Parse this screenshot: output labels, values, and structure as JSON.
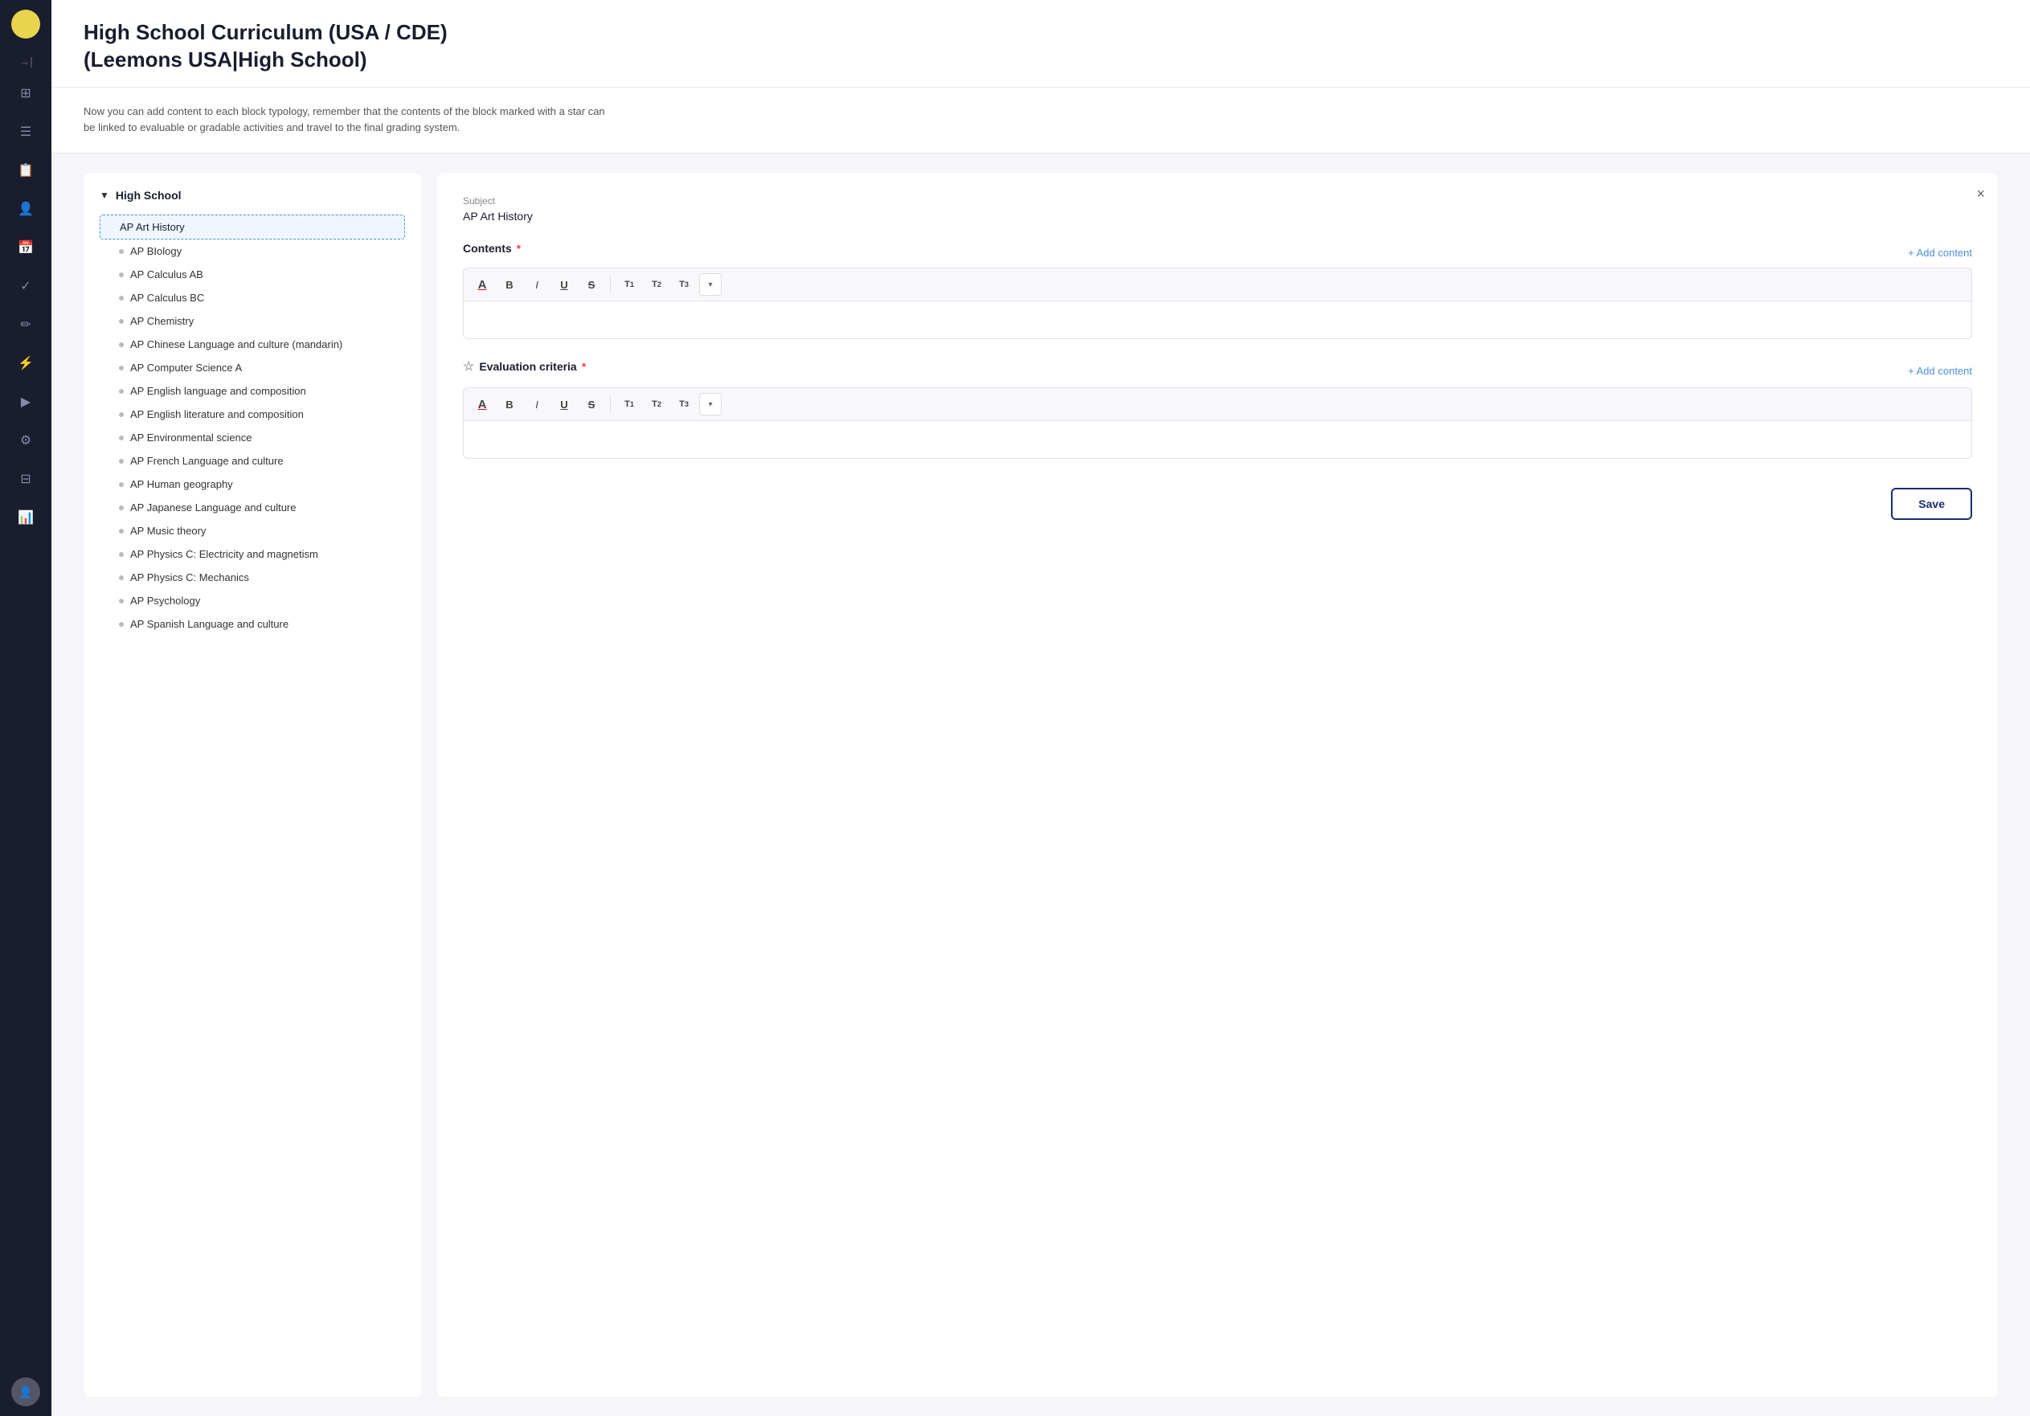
{
  "sidebar": {
    "icons": [
      {
        "name": "dashboard-icon",
        "symbol": "⊞"
      },
      {
        "name": "content-icon",
        "symbol": "☰"
      },
      {
        "name": "assignment-icon",
        "symbol": "📋"
      },
      {
        "name": "users-icon",
        "symbol": "👤"
      },
      {
        "name": "calendar-icon",
        "symbol": "📅"
      },
      {
        "name": "tasks-icon",
        "symbol": "✓"
      },
      {
        "name": "edit-icon",
        "symbol": "✏"
      },
      {
        "name": "activity-icon",
        "symbol": "⚡"
      },
      {
        "name": "run-icon",
        "symbol": "▶"
      },
      {
        "name": "tools-icon",
        "symbol": "🔧"
      },
      {
        "name": "layout-icon",
        "symbol": "⊟"
      },
      {
        "name": "chart-icon",
        "symbol": "📊"
      }
    ]
  },
  "header": {
    "title_line1": "High School Curriculum (USA / CDE)",
    "title_line2": "(Leemons USA|High School)",
    "description": "Now you can add content to each block typology, remember that the contents of the block marked with a star can\nbe linked to evaluable or gradable activities and travel to the final grading system."
  },
  "tree": {
    "root_label": "High School",
    "items": [
      {
        "label": "AP Art History",
        "selected": true
      },
      {
        "label": "AP BIology",
        "selected": false
      },
      {
        "label": "AP Calculus AB",
        "selected": false
      },
      {
        "label": "AP Calculus BC",
        "selected": false
      },
      {
        "label": "AP Chemistry",
        "selected": false
      },
      {
        "label": "AP Chinese Language and culture (mandarin)",
        "selected": false
      },
      {
        "label": "AP Computer Science A",
        "selected": false
      },
      {
        "label": "AP English language and composition",
        "selected": false
      },
      {
        "label": "AP English literature and composition",
        "selected": false
      },
      {
        "label": "AP Environmental science",
        "selected": false
      },
      {
        "label": "AP French Language and culture",
        "selected": false
      },
      {
        "label": "AP Human geography",
        "selected": false
      },
      {
        "label": "AP Japanese Language and culture",
        "selected": false
      },
      {
        "label": "AP Music theory",
        "selected": false
      },
      {
        "label": "AP Physics C: Electricity and magnetism",
        "selected": false
      },
      {
        "label": "AP Physics C: Mechanics",
        "selected": false
      },
      {
        "label": "AP Psychology",
        "selected": false
      },
      {
        "label": "AP Spanish Language and culture",
        "selected": false
      }
    ]
  },
  "editor": {
    "close_label": "×",
    "subject_label": "Subject",
    "subject_value": "AP Art History",
    "contents_label": "Contents",
    "contents_required": "*",
    "add_content_label": "+ Add content",
    "evaluation_label": "Evaluation criteria",
    "evaluation_required": "*",
    "save_label": "Save",
    "toolbar": {
      "font_btn": "A",
      "bold_btn": "B",
      "italic_btn": "I",
      "underline_btn": "U",
      "strike_btn": "S",
      "t1_btn": "T₁",
      "t2_btn": "T₂",
      "t3_btn": "T₃",
      "dropdown_btn": "▾"
    }
  }
}
